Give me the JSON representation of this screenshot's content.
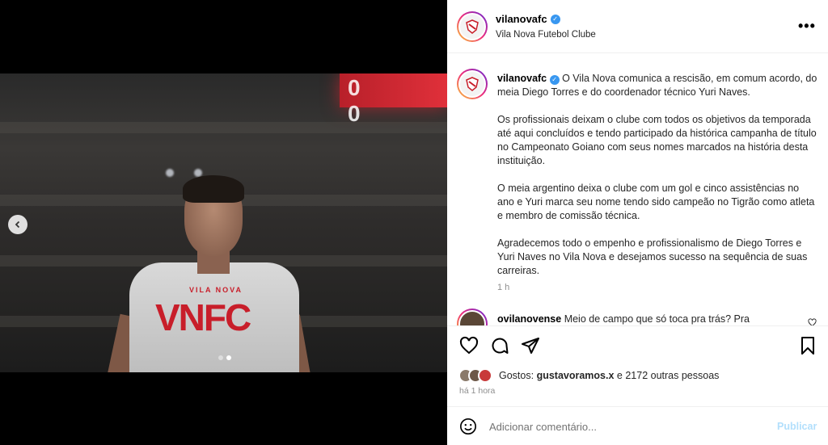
{
  "post": {
    "username": "vilanovafc",
    "subtitle": "Vila Nova Futebol Clube",
    "more_icon": "more-horizontal-icon",
    "verified_icon": "verified-badge-icon"
  },
  "media": {
    "scoreboard_text": "0 0",
    "shirt_top_text": "VILA NOVA",
    "shirt_text": "VNFC",
    "carousel": {
      "count": 2,
      "active_index": 1
    },
    "prev_icon": "chevron-left-icon"
  },
  "caption": {
    "username": "vilanovafc",
    "paragraphs": [
      "O Vila Nova comunica a rescisão, em comum acordo, do meia Diego Torres e do coordenador técnico Yuri Naves.",
      "Os profissionais deixam o clube com todos os objetivos da temporada até aqui concluídos e tendo participado da histórica campanha de título no Campeonato Goiano com seus nomes marcados na história desta instituição.",
      "O meia argentino deixa o clube com um gol e cinco assistências no ano e Yuri marca seu nome tendo sido campeão no Tigrão como atleta e membro de comissão técnica.",
      "Agradecemos todo o empenho e profissionalismo de Diego Torres e Yuri Naves no Vila Nova e desejamos sucesso na sequência de suas carreiras."
    ],
    "time": "1 h"
  },
  "comment": {
    "username": "ovilanovense",
    "text": "Meio de campo que só toca pra trás? Pra"
  },
  "actions": {
    "icons": [
      "heart-icon",
      "comment-icon",
      "share-icon",
      "bookmark-icon"
    ],
    "likes_prefix": "Gostos:",
    "likes_user": "gustavoramos.x",
    "likes_suffix": "e 2172 outras pessoas",
    "time": "há 1 hora"
  },
  "composer": {
    "placeholder": "Adicionar comentário...",
    "publish_label": "Publicar",
    "emoji_icon": "emoji-icon"
  },
  "colors": {
    "verified": "#3897f0",
    "publish_disabled": "#b2dffc",
    "brand_red": "#c81e2a"
  }
}
